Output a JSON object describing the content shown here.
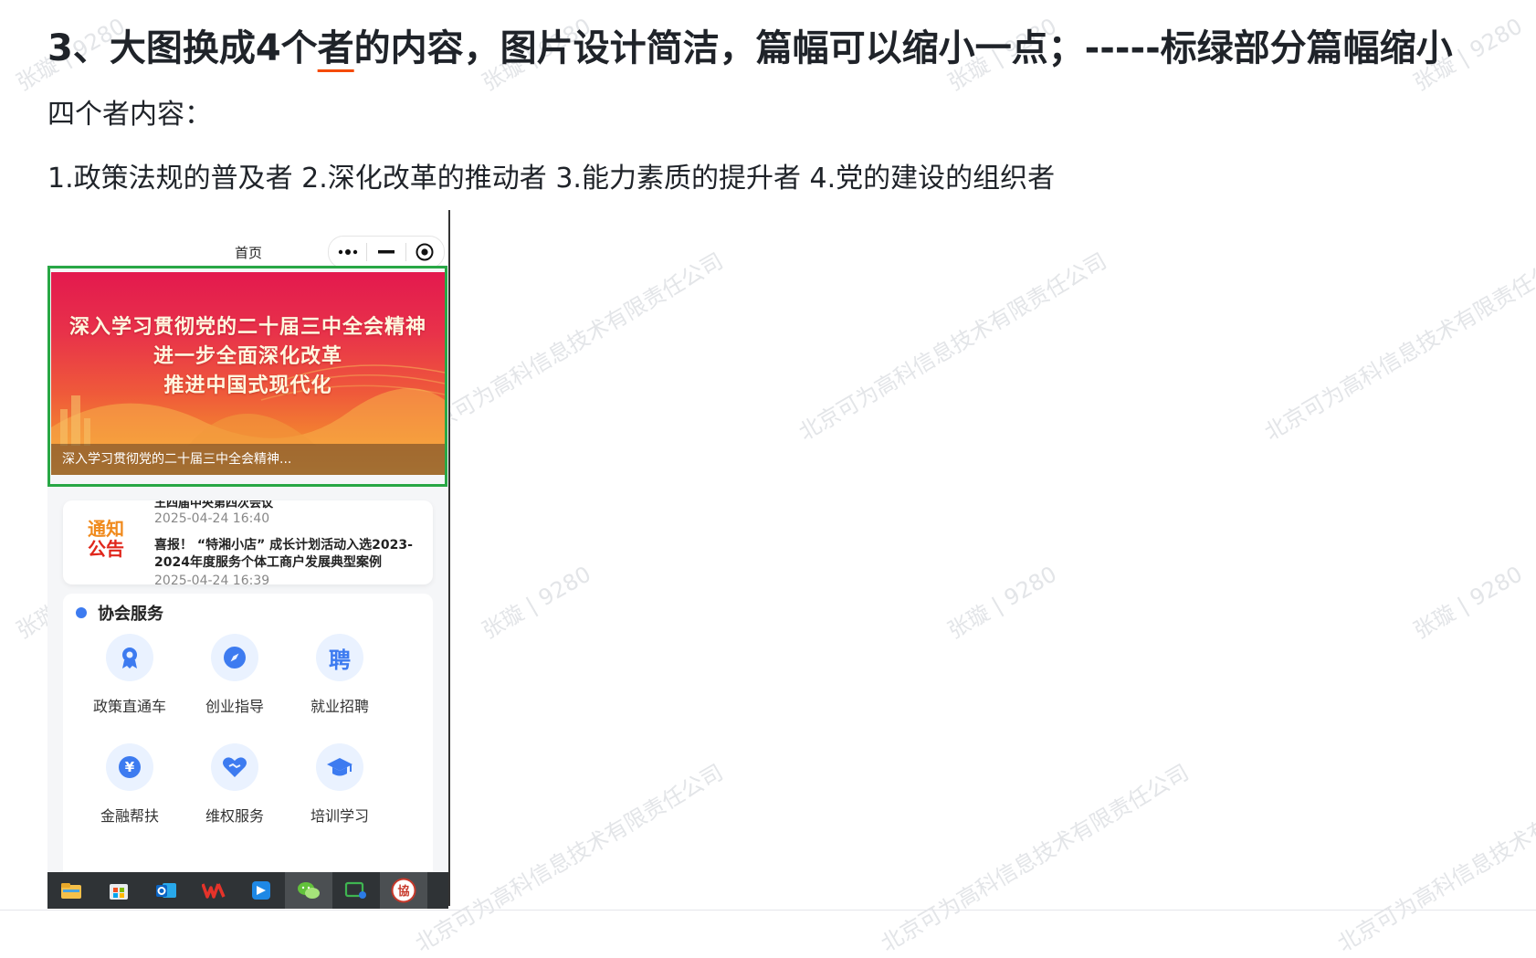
{
  "document": {
    "title_prefix": "3、大图换成4个",
    "title_underlined": "者",
    "title_suffix": "的内容，图片设计简洁，篇幅可以缩小一点；-----标绿部分篇幅缩小",
    "subtitle": "四个者内容：",
    "items_line": "1.政策法规的普及者 2.深化改革的推动者 3.能力素质的提升者 4.党的建设的组织者"
  },
  "watermarks": {
    "name_tag": "张璇 | 9280",
    "company": "北京可为高科信息技术有限责任公司"
  },
  "phone": {
    "nav_title": "首页",
    "capsule_icons": [
      "more-icon",
      "minimize-icon",
      "close-target-icon"
    ],
    "banner": {
      "line1": "深入学习贯彻党的二十届三中全会精神",
      "line2": "进一步全面深化改革",
      "line3": "推进中国式现代化",
      "caption": "深入学习贯彻党的二十届三中全会精神..."
    },
    "notice": {
      "logo_line1": "通知",
      "logo_line2": "公告",
      "cut_title": "王四届中央第四次会议",
      "date1": "2025-04-24 16:40",
      "title": "喜报！ “特湘小店” 成长计划活动入选2023-2024年度服务个体工商户发展典型案例",
      "date2": "2025-04-24 16:39"
    },
    "services": {
      "title": "协会服务",
      "items": [
        {
          "label": "政策直通车",
          "icon": "award-ribbon-icon"
        },
        {
          "label": "创业指导",
          "icon": "compass-icon"
        },
        {
          "label": "就业招聘",
          "icon": "recruit-pin-icon",
          "glyph": "聘"
        },
        {
          "label": "金融帮扶",
          "icon": "yuan-coin-icon",
          "glyph": "¥"
        },
        {
          "label": "维权服务",
          "icon": "handshake-heart-icon"
        },
        {
          "label": "培训学习",
          "icon": "graduation-cap-icon"
        }
      ]
    }
  },
  "taskbar": {
    "icons": [
      "file-explorer-icon",
      "store-icon",
      "outlook-icon",
      "wps-icon",
      "feishu-icon",
      "wechat-icon",
      "wecom-icon",
      "association-app-icon"
    ],
    "association_glyph": "協"
  },
  "colors": {
    "accent_underline": "#f54a00",
    "green_frame": "#28a745",
    "service_blue": "#3d7bf0"
  }
}
